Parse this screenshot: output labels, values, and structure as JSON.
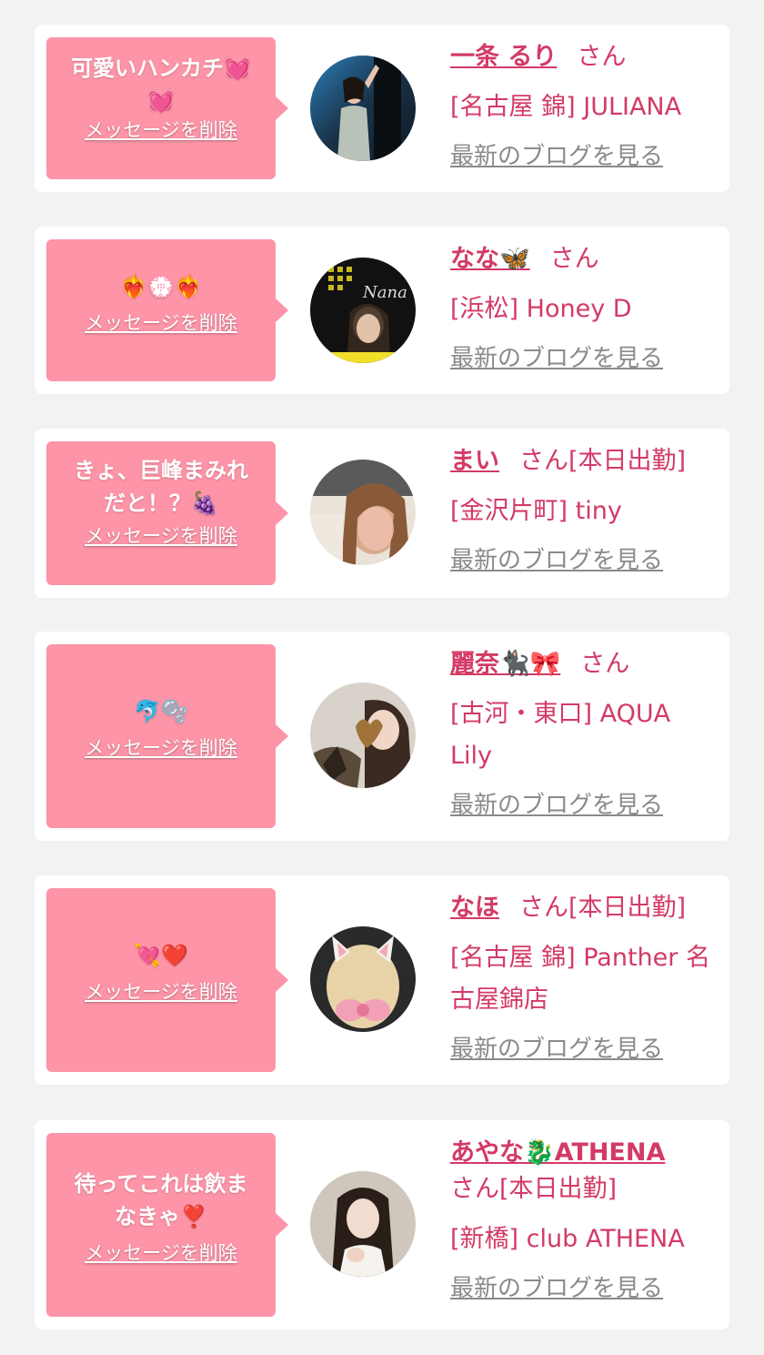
{
  "delete_label": "メッセージを削除",
  "blog_label": "最新のブログを見る",
  "honorific": "さん",
  "colors": {
    "bubble": "#fd94a7",
    "accent": "#d33a66",
    "muted": "#8a8a8a",
    "background": "#f2f2f2"
  },
  "cards": [
    {
      "message": "可愛いハンカチ💓",
      "message_line2": "💓",
      "name": "一条 るり",
      "status": "",
      "shop": "[名古屋 錦] JULIANA",
      "shop_line2": "",
      "avatar_icon": "woman-photo"
    },
    {
      "message": "❤️‍🔥💮❤️‍🔥",
      "message_line2": "",
      "name": "なな🦋",
      "status": "",
      "shop": "[浜松] Honey D",
      "shop_line2": "",
      "avatar_icon": "woman-photo"
    },
    {
      "message": "きょ、巨峰まみれ",
      "message_line2": "だと！？🍇",
      "name": "まい",
      "status": "[本日出勤]",
      "shop": "[金沢片町] tiny",
      "shop_line2": "",
      "avatar_icon": "woman-photo"
    },
    {
      "message": "🐬🫧",
      "message_line2": "",
      "name": "麗奈🐈‍⬛🎀",
      "status": "",
      "shop": "[古河・東口] AQUA",
      "shop_line2": "Lily",
      "avatar_icon": "woman-photo"
    },
    {
      "message": "💘❤️",
      "message_line2": "",
      "name": "なほ",
      "status": "[本日出勤]",
      "shop": "[名古屋 錦] Panther 名",
      "shop_line2": "古屋錦店",
      "avatar_icon": "woman-photo"
    },
    {
      "message": "待ってこれは飲ま",
      "message_line2": "なきゃ❣️",
      "name": "あやな🐉ATHENA",
      "status": "[本日出勤]",
      "shop": "[新橋] club ATHENA",
      "shop_line2": "",
      "avatar_icon": "woman-photo"
    }
  ]
}
